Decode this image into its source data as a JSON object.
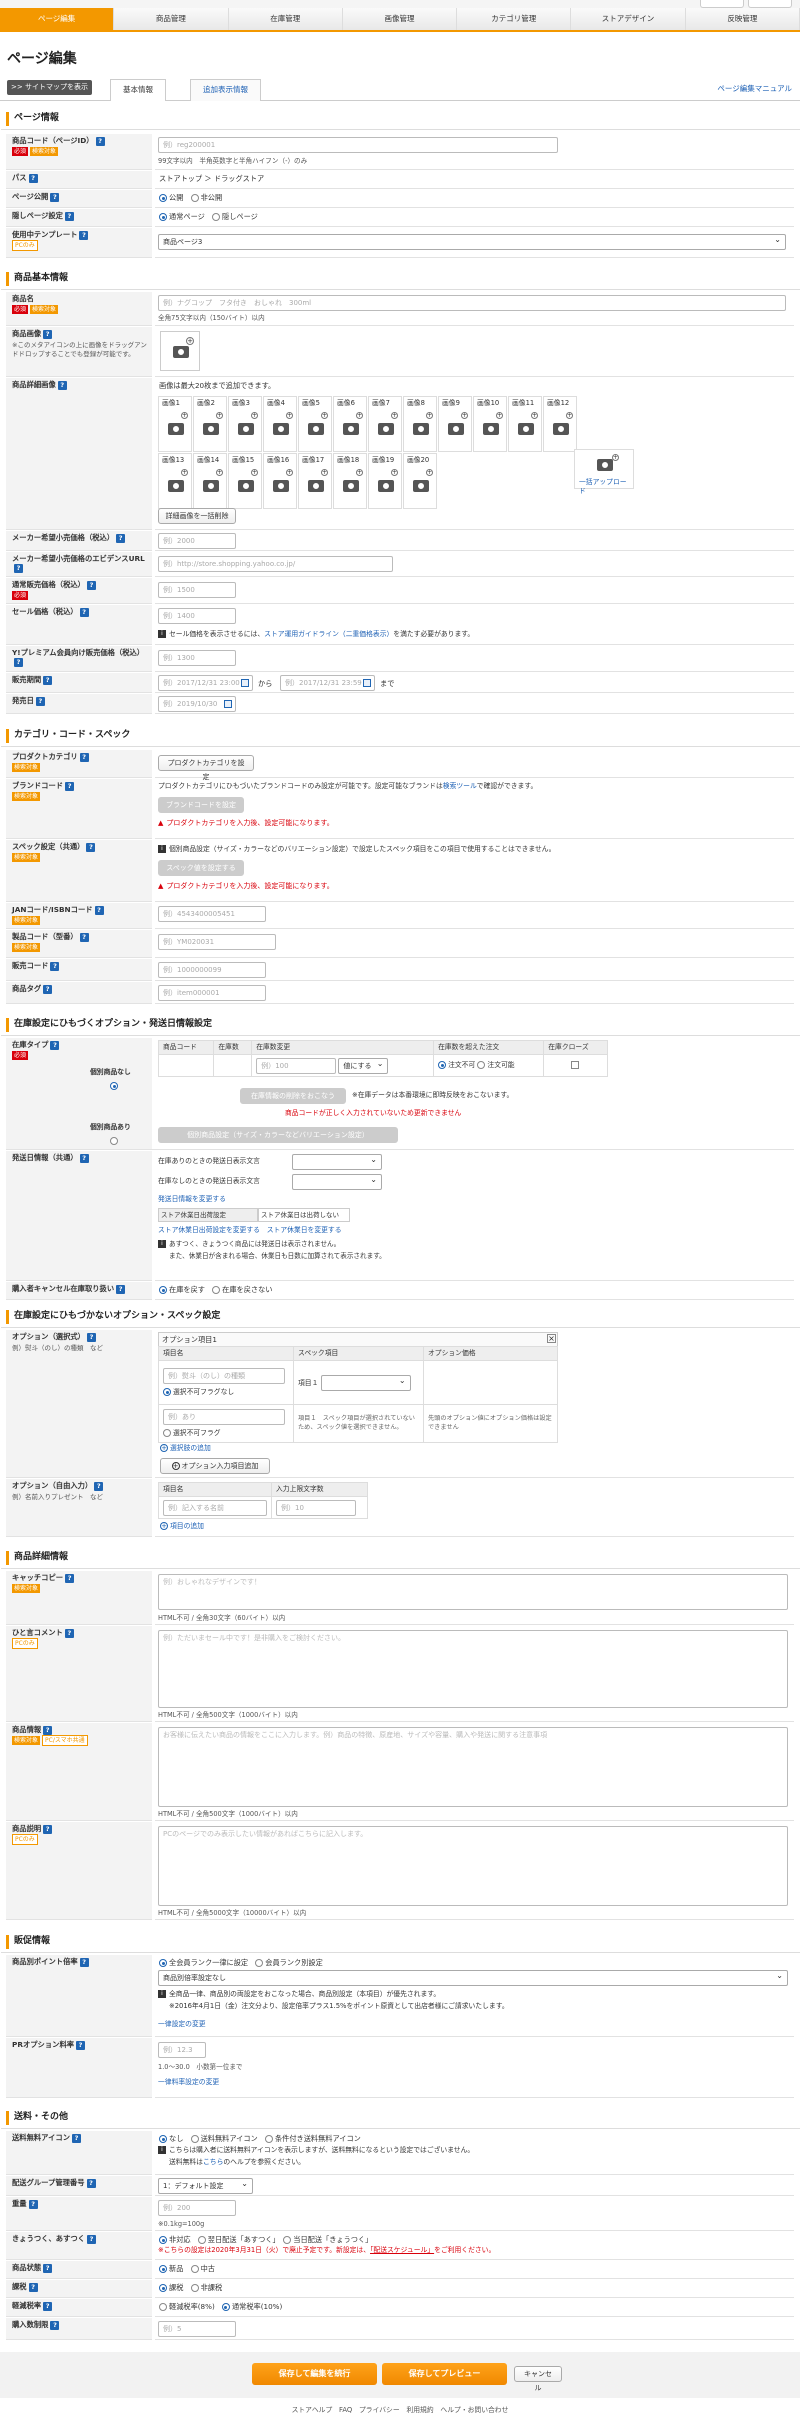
{
  "nav": [
    "ページ編集",
    "商品管理",
    "在庫管理",
    "画像管理",
    "カテゴリ管理",
    "ストアデザイン",
    "反映管理"
  ],
  "page_title": "ページ編集",
  "sitemap_btn": "サイトマップを表示",
  "tabs": [
    "基本情報",
    "追加表示情報"
  ],
  "manual_link": "ページ編集マニュアル",
  "badges": {
    "required": "必須",
    "search": "検索対象",
    "pc_only": "PCのみ",
    "pc_smart": "PC/スマホ共通"
  },
  "sec1": {
    "title": "ページ情報",
    "code_label": "商品コード（ページID）",
    "code_ph": "例）reg200001",
    "code_note": "99文字以内　半角英数字と半角ハイフン（-）のみ",
    "path_label": "パス",
    "path_value": "ストアトップ ＞ ドラッグストア",
    "publish_label": "ページ公開",
    "publish_opts": [
      "公開",
      "非公開"
    ],
    "hidden_label": "隠しページ設定",
    "hidden_opts": [
      "通常ページ",
      "隠しページ"
    ],
    "template_label": "使用中テンプレート",
    "template_value": "商品ページ3"
  },
  "sec2": {
    "title": "商品基本情報",
    "name_label": "商品名",
    "name_ph": "例）ナグコップ　フタ付き　おしゃれ　300ml",
    "name_note": "全角75文字以内（150バイト）以内",
    "image_label": "商品画像",
    "image_sub": "※このメタアイコンの上に画像をドラッグアンドドロップすることでも登録が可能です。",
    "detail_label": "商品詳細画像",
    "detail_note": "画像は最大20枚まで追加できます。",
    "images": [
      "画像1",
      "画像2",
      "画像3",
      "画像4",
      "画像5",
      "画像6",
      "画像7",
      "画像8",
      "画像9",
      "画像10",
      "画像11",
      "画像12",
      "画像13",
      "画像14",
      "画像15",
      "画像16",
      "画像17",
      "画像18",
      "画像19",
      "画像20"
    ],
    "bulk_upload": "一括アップロード",
    "bulk_delete": "詳細画像を一括削除",
    "maker_price_label": "メーカー希望小売価格（税込）",
    "maker_price_ph": "例）2000",
    "evidence_label": "メーカー希望小売価格のエビデンスURL",
    "evidence_ph": "例）http://store.shopping.yahoo.co.jp/",
    "normal_price_label": "通常販売価格（税込）",
    "normal_price_ph": "例）1500",
    "sale_price_label": "セール価格（税込）",
    "sale_price_ph": "例）1400",
    "sale_note_a": "セール価格を表示させるには、",
    "sale_note_link": "ストア運用ガイドライン（二重価格表示）",
    "sale_note_b": "を満たす必要があります。",
    "premium_label": "Y!プレミアム会員向け販売価格（税込）",
    "premium_ph": "例）1300",
    "period_label": "販売期間",
    "period_from_ph": "例）2017/12/31 23:00",
    "period_to_ph": "例）2017/12/31 23:59",
    "from": "から",
    "to": "まで",
    "release_label": "発売日",
    "release_ph": "例）2019/10/30"
  },
  "sec3": {
    "title": "カテゴリ・コード・スペック",
    "pcat_label": "プロダクトカテゴリ",
    "pcat_btn": "プロダクトカテゴリを設定",
    "brand_label": "ブランドコード",
    "brand_note_a": "プロダクトカテゴリにひもづいたブランドコードのみ設定が可能です。設定可能なブランドは",
    "brand_note_link": "検索ツール",
    "brand_note_b": "で確認ができます。",
    "brand_btn": "ブランドコードを設定",
    "pcat_warn": "プロダクトカテゴリを入力後、設定可能になります。",
    "spec_label": "スペック設定（共通）",
    "spec_note": "個別商品設定（サイズ・カラーなどのバリエーション設定）で設定したスペック項目をこの項目で使用することはできません。",
    "spec_btn": "スペック値を設定する",
    "jan_label": "JANコード/ISBNコード",
    "jan_ph": "例）4543400005451",
    "model_label": "製品コード（型番）",
    "model_ph": "例）YM020031",
    "sales_code_label": "販売コード",
    "sales_code_ph": "例）1000000099",
    "tag_label": "商品タグ",
    "tag_ph": "例）item000001"
  },
  "sec4": {
    "title": "在庫設定にひもづくオプション・発送日情報設定",
    "type_label": "在庫タイプ",
    "none_label": "個別商品なし",
    "has_label": "個別商品あり",
    "table_headers": [
      "商品コード",
      "在庫数",
      "在庫数変更",
      "在庫数を超えた注文",
      "在庫クローズ"
    ],
    "stock_ph": "例）100",
    "stock_mode": "値にする",
    "over_opts": [
      "注文不可",
      "注文可能"
    ],
    "delete_btn": "在庫情報の削除をおこなう",
    "delete_note": "※在庫データは本番環境に即時反映をおこないます。",
    "code_warn": "商品コードが正しく入力されていないため更新できません",
    "variation_btn": "個別商品設定（サイズ・カラーなどバリエーション設定）",
    "ship_label": "発送日情報（共通）",
    "ship_in": "在庫ありのときの発送日表示文言",
    "ship_out": "在庫なしのときの発送日表示文言",
    "ship_change": "発送日情報を変更する",
    "holiday_tab1": "ストア休業日出荷設定",
    "holiday_tab2": "ストア休業日は出荷しない",
    "holiday_link1": "ストア休業日出荷設定を変更する",
    "holiday_link2": "ストア休業日を変更する",
    "holiday_note1": "あすつく、きょうつく商品には発送日は表示されません。",
    "holiday_note2": "また、休業日が含まれる場合、休業日も日数に加算されて表示されます。",
    "cancel_label": "購入者キャンセル在庫取り扱い",
    "cancel_opts": [
      "在庫を戻す",
      "在庫を戻さない"
    ]
  },
  "sec5": {
    "title": "在庫設定にひもづかないオプション・スペック設定",
    "opt_label": "オプション（選択式）",
    "opt_sub": "例）熨斗（のし）の種類　など",
    "opt_box_title": "オプション項目1",
    "opt_headers": [
      "項目名",
      "スペック項目",
      "オプション価格"
    ],
    "opt_name_ph": "例）熨斗（のし）の種類",
    "opt_flag": "選択不可フラグなし",
    "opt_spec": "項目１",
    "opt_val_ph": "例）あり",
    "opt_flag2": "選択不可フラグ",
    "opt_spec_note": "スペック項目が選択されていないため、スペック値を選択できません。",
    "opt_price_note": "先頭のオプション値にオプション価格は設定できません",
    "add_choice": "選択肢の追加",
    "add_option": "オプション入力項目追加",
    "free_label": "オプション（自由入力）",
    "free_sub": "例）名前入りプレゼント　など",
    "free_headers": [
      "項目名",
      "入力上限文字数"
    ],
    "free_name_ph": "例）記入する名前",
    "free_len_ph": "例）10",
    "add_item": "項目の追加"
  },
  "sec6": {
    "title": "商品詳細情報",
    "catch_label": "キャッチコピー",
    "catch_ph": "例）おしゃれなデザインです！",
    "catch_note": "HTML不可 / 全角30文字（60バイト）以内",
    "comment_label": "ひと言コメント",
    "comment_ph": "例）ただいまセール中です！是非購入をご検討ください。",
    "comment_note": "HTML不可 / 全角500文字（1000バイト）以内",
    "info_label": "商品情報",
    "info_ph": "お客様に伝えたい商品の情報をここに入力します。例）商品の特徴、原産地、サイズや容量、購入や発送に関する注意事項",
    "info_note": "HTML不可 / 全角500文字（1000バイト）以内",
    "desc_label": "商品説明",
    "desc_ph": "PCのページでのみ表示したい情報があればこちらに記入します。",
    "desc_note": "HTML不可 / 全角5000文字（10000バイト）以内"
  },
  "sec7": {
    "title": "販促情報",
    "point_label": "商品別ポイント倍率",
    "point_opts": [
      "全会員ランク一律に設定",
      "会員ランク別設定"
    ],
    "point_select": "商品別倍率設定なし",
    "point_note1": "全商品一律、商品別の両設定をおこなった場合、商品別設定（本項目）が優先されます。",
    "point_note2": "※2016年4月1日（金）注文分より、設定倍率プラス1.5%をポイント原資として出店者様にご請求いたします。",
    "point_link": "一律設定の変更",
    "pr_label": "PRオプション料率",
    "pr_ph": "例）12.3",
    "pr_note": "1.0〜30.0　小数第一位まで",
    "pr_link": "一律料率設定の変更"
  },
  "sec8": {
    "title": "送料・その他",
    "ship_icon_label": "送料無料アイコン",
    "ship_icon_opts": [
      "なし",
      "送料無料アイコン",
      "条件付き送料無料アイコン"
    ],
    "ship_icon_note1": "こちらは購入者に送料無料アイコンを表示しますが、送料無料になるという設定ではございません。",
    "ship_icon_note2a": "送料無料は",
    "ship_icon_note2_link": "こちら",
    "ship_icon_note2b": "のヘルプを参照ください。",
    "group_label": "配送グループ管理番号",
    "group_value": "1：デフォルト設定",
    "weight_label": "重量",
    "weight_ph": "例）200",
    "weight_note": "※0.1kg=100g",
    "asu_label": "きょうつく、あすつく",
    "asu_opts": [
      "非対応",
      "翌日配送「あすつく」",
      "当日配送「きょうつく」"
    ],
    "asu_note_a": "※こちらの設定は2020年3月31日（火）で廃止予定です。新設定は、",
    "asu_note_link": "「配送スケジュール」",
    "asu_note_b": "をご利用ください。",
    "cond_label": "商品状態",
    "cond_opts": [
      "新品",
      "中古"
    ],
    "tax_label": "課税",
    "tax_opts": [
      "課税",
      "非課税"
    ],
    "rate_label": "軽減税率",
    "rate_opts": [
      "軽減税率(8%)",
      "通常税率(10%)"
    ],
    "limit_label": "購入数制限",
    "limit_ph": "例）5"
  },
  "footer": {
    "save_continue": "保存して編集を続行",
    "save_preview": "保存してプレビュー",
    "cancel": "キャンセル",
    "links": "ストアヘルプ　FAQ　プライバシー　利用規約　ヘルプ・お問い合わせ"
  }
}
